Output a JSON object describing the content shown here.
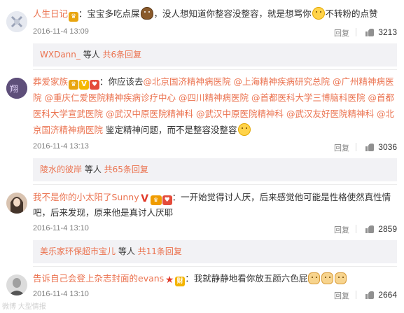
{
  "comments": [
    {
      "user": "人生日记",
      "text_before": "：宝宝多吃点屎",
      "text_middle": "，没人想知道你整容没整容，就是想骂你",
      "text_after": "不转粉的点赞",
      "time": "2016-11-4 13:09",
      "reply_label": "回复",
      "likes": "3213",
      "sub_reply": {
        "name": "WXDann_",
        "mid": " 等人 ",
        "more": "共6条回复"
      }
    },
    {
      "user": "葬爱家族",
      "text_before": "：你应该去",
      "mentions": [
        "@北京国济精神病医院",
        "@上海精神疾病研究总院",
        "@广州精神病医院",
        "@重庆仁爱医院精神疾病诊疗中心",
        "@四川精神病医院",
        "@首都医科大学三博脑科医院",
        "@首都医科大学宣武医院",
        "@武汉中原医院精神科",
        "@武汉中原医院精神科",
        "@武汉友好医院精神科",
        "@北京国济精神病医院"
      ],
      "text_after": "鉴定精神问题，而不是整容没整容",
      "time": "2016-11-4 13:13",
      "reply_label": "回复",
      "likes": "3036",
      "sub_reply": {
        "name": "陵水的彼岸",
        "mid": " 等人 ",
        "more": "共65条回复"
      }
    },
    {
      "user": "我不是你的小太阳了Sunny",
      "text": "：一开始觉得讨人厌，后来感觉他可能是性格使然真性情吧，后来发现，原来他是真讨人厌耶",
      "time": "2016-11-4 13:10",
      "reply_label": "回复",
      "likes": "2859",
      "sub_reply": {
        "name": "美乐家环保超市宝儿",
        "mid": " 等人 ",
        "more": "共11条回复"
      }
    },
    {
      "user": "告诉自己会登上杂志封面的evans",
      "text": "：我就静静地看你放五颜六色屁",
      "time": "2016-11-4 13:10",
      "reply_label": "回复",
      "likes": "2664"
    }
  ],
  "watermark": "微博 大型情报"
}
